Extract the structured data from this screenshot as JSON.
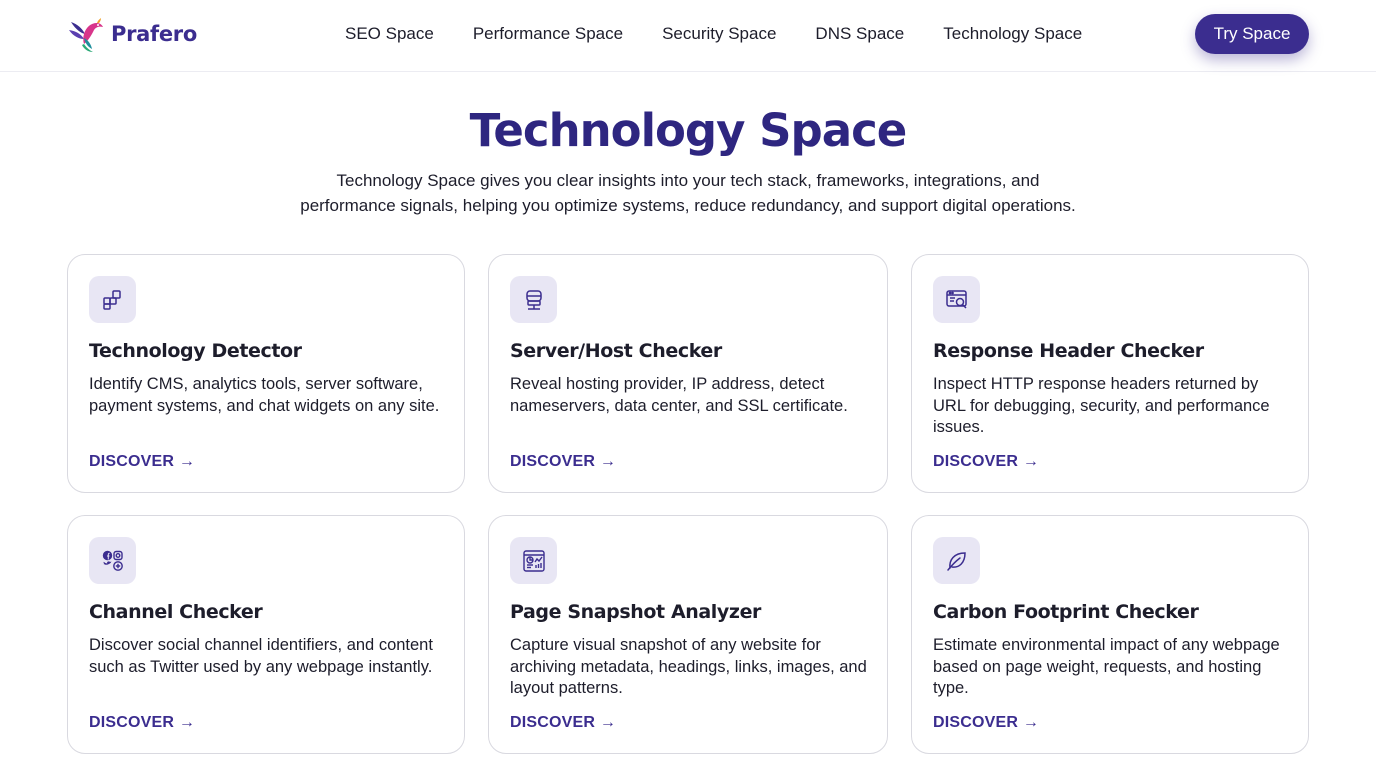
{
  "brand": {
    "name": "Prafero",
    "accent": "#3b2d8f",
    "icon_bg": "#e8e6f4"
  },
  "nav": {
    "items": [
      {
        "label": "SEO Space"
      },
      {
        "label": "Performance Space"
      },
      {
        "label": "Security Space"
      },
      {
        "label": "DNS Space"
      },
      {
        "label": "Technology Space"
      }
    ],
    "cta_label": "Try Space"
  },
  "hero": {
    "title": "Technology Space",
    "description": "Technology Space gives you clear insights into your tech stack, frameworks, integrations, and performance signals, helping you optimize systems, reduce redundancy, and support digital operations."
  },
  "cards": [
    {
      "icon": "blocks-icon",
      "title": "Technology Detector",
      "description": "Identify CMS, analytics tools, server software, payment systems, and chat widgets on any site.",
      "link": "DISCOVER →"
    },
    {
      "icon": "server-icon",
      "title": "Server/Host Checker",
      "description": "Reveal hosting provider, IP address, detect nameservers, data center, and SSL certificate.",
      "link": "DISCOVER →"
    },
    {
      "icon": "browser-search-icon",
      "title": "Response Header Checker",
      "description": "Inspect HTTP response headers returned by URL for debugging, security, and performance issues.",
      "link": "DISCOVER →"
    },
    {
      "icon": "social-icons",
      "title": "Channel Checker",
      "description": "Discover social channel identifiers, and content such as Twitter used by any webpage instantly.",
      "link": "DISCOVER →"
    },
    {
      "icon": "dashboard-icon",
      "title": "Page Snapshot Analyzer",
      "description": "Capture visual snapshot of any website for archiving metadata, headings, links, images, and layout patterns.",
      "link": "DISCOVER →"
    },
    {
      "icon": "leaf-icon",
      "title": "Carbon Footprint Checker",
      "description": "Estimate environmental impact of any webpage based on page weight, requests, and hosting type.",
      "link": "DISCOVER →"
    }
  ]
}
